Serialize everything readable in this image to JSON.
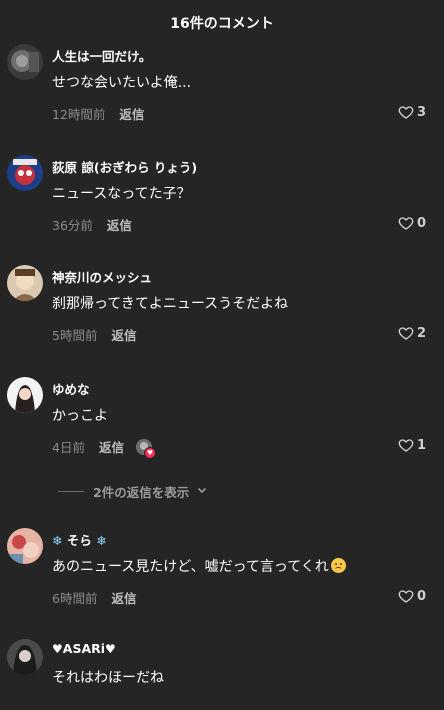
{
  "header": {
    "title": "16件のコメント"
  },
  "comments": [
    {
      "username": "人生は一回だけ。",
      "text": "せつな会いたいよ俺...",
      "time": "12時間前",
      "reply": "返信",
      "likes": "3"
    },
    {
      "username": "荻原 諒(おぎわら りょう)",
      "text": "ニュースなってた子？",
      "time": "36分前",
      "reply": "返信",
      "likes": "0"
    },
    {
      "username": "神奈川のメッシュ",
      "text": "刹那帰ってきてよニュースうそだよね",
      "time": "5時間前",
      "reply": "返信",
      "likes": "2"
    },
    {
      "username": "ゆめな",
      "text": "かっこよ",
      "time": "4日前",
      "reply": "返信",
      "likes": "1"
    },
    {
      "username": "そら",
      "text": "あのニュース見たけど、嘘だって言ってくれ",
      "time": "6時間前",
      "reply": "返信",
      "likes": "0"
    },
    {
      "username": "ASARi",
      "text": "それはわほーだね"
    }
  ],
  "replies_toggle": {
    "label": "2件の返信を表示"
  },
  "icons": {
    "like": "heart-outline-icon",
    "chevron": "chevron-down-icon",
    "snowflake": "❄",
    "heart": "♥"
  },
  "colors": {
    "background": "#252525",
    "muted": "#8a8a8a",
    "reply": "#bdbdbd",
    "badge": "#fe2c55"
  }
}
